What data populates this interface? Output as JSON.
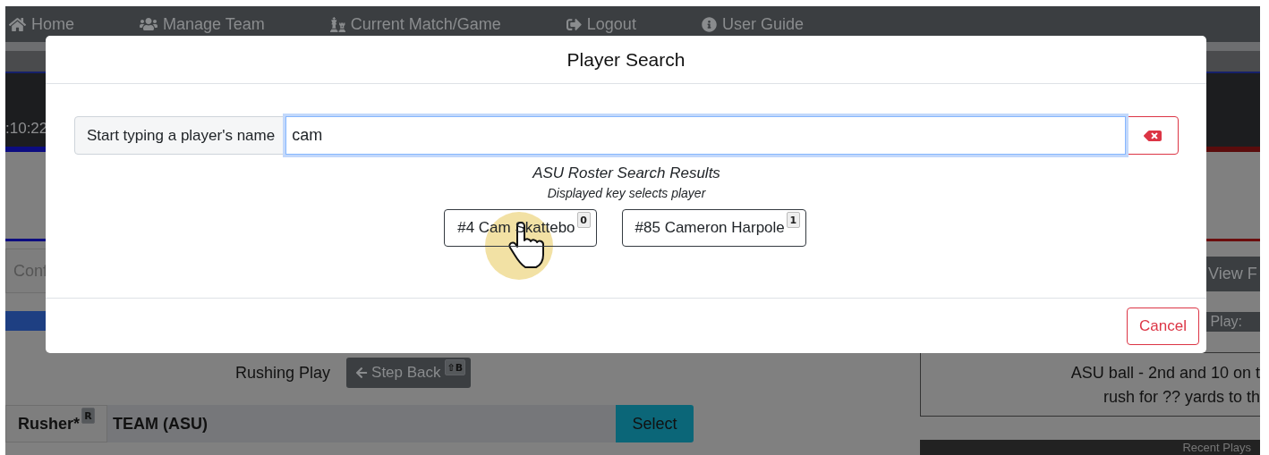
{
  "nav": {
    "items": [
      {
        "label": "Home",
        "kind": "home"
      },
      {
        "label": "Manage Team",
        "kind": "team"
      },
      {
        "label": "Current Match/Game",
        "kind": "match"
      },
      {
        "label": "Logout",
        "kind": "logout"
      },
      {
        "label": "User Guide",
        "kind": "guide"
      }
    ]
  },
  "scoreboard": {
    "clock": ":10:22"
  },
  "page": {
    "conf_field": "Conf",
    "view_button": "View F",
    "play_header": "Play:",
    "play_type": "Rushing Play",
    "step_back": {
      "label": "Step Back",
      "key": "⇧B"
    },
    "rusher": {
      "label": "Rusher*",
      "key": "R",
      "value": "TEAM (ASU)",
      "button": "Select"
    },
    "play_summary": [
      "ASU ball - 2nd and 10 on t",
      "rush for ?? yards to th"
    ],
    "recent_header": "Recent Plays"
  },
  "modal": {
    "title": "Player Search",
    "search": {
      "label": "Start typing a player's name",
      "value": "cam"
    },
    "results_title": "ASU Roster Search Results",
    "results_hint": "Displayed key selects player",
    "results": [
      {
        "label": "#4 Cam Skattebo",
        "key": "0"
      },
      {
        "label": "#85 Cameron Harpole",
        "key": "1"
      }
    ],
    "cancel": "Cancel"
  }
}
